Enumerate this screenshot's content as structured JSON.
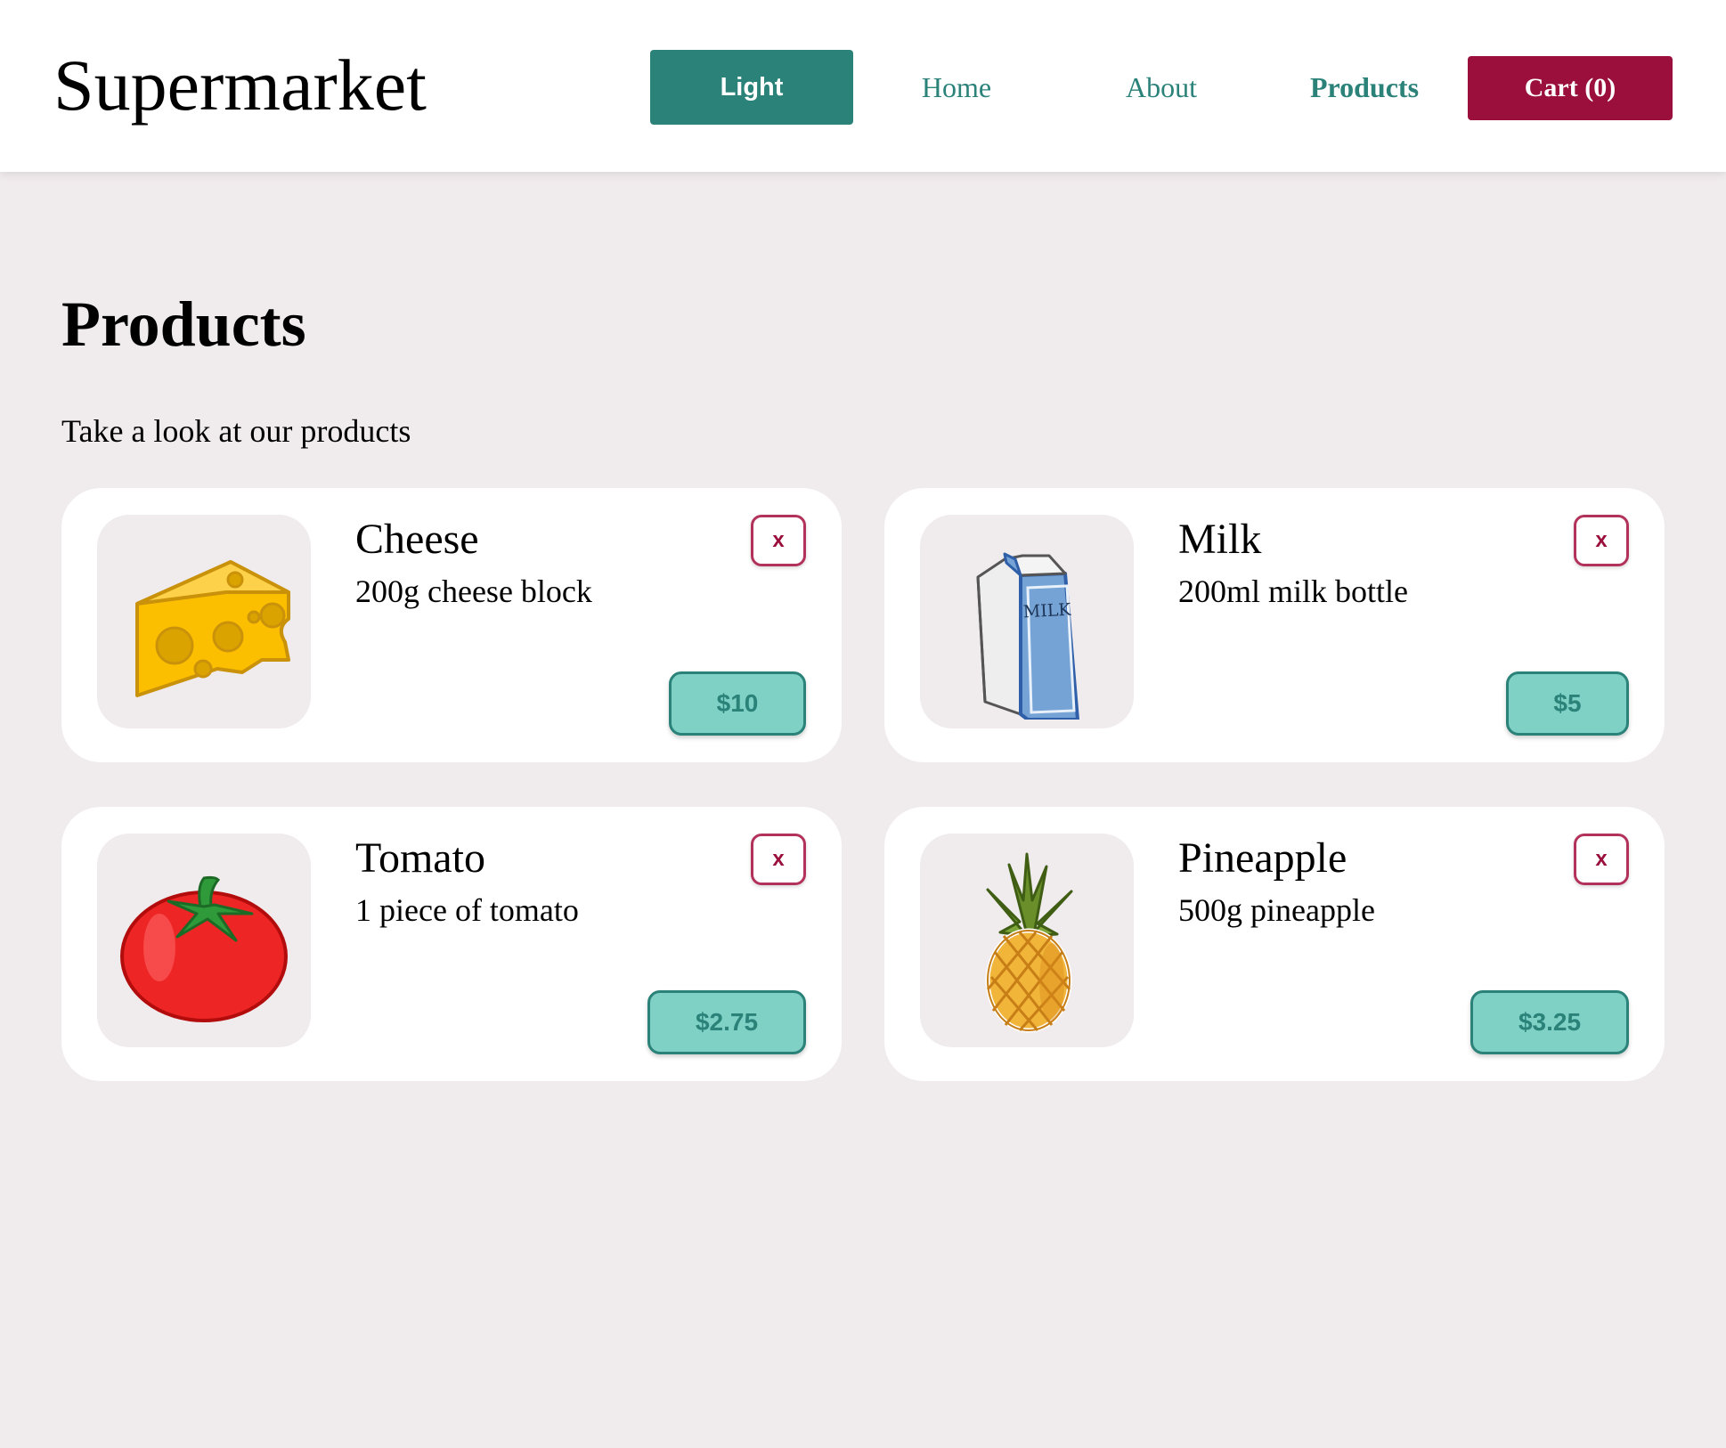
{
  "header": {
    "logo": "Supermarket",
    "theme_toggle_label": "Light",
    "nav": {
      "home": "Home",
      "about": "About",
      "products": "Products"
    },
    "cart_label": "Cart (0)"
  },
  "main": {
    "title": "Products",
    "subtitle": "Take a look at our products"
  },
  "products": [
    {
      "name": "Cheese",
      "description": "200g cheese block",
      "price": "$10",
      "remove_label": "x",
      "icon": "cheese-icon"
    },
    {
      "name": "Milk",
      "description": "200ml milk bottle",
      "price": "$5",
      "remove_label": "x",
      "icon": "milk-carton-icon",
      "icon_text": "MILK"
    },
    {
      "name": "Tomato",
      "description": "1 piece of tomato",
      "price": "$2.75",
      "remove_label": "x",
      "icon": "tomato-icon"
    },
    {
      "name": "Pineapple",
      "description": "500g pineapple",
      "price": "$3.25",
      "remove_label": "x",
      "icon": "pineapple-icon"
    }
  ],
  "colors": {
    "accent": "#2a8279",
    "cart": "#9a0f3c",
    "price_bg": "#7fd0c5",
    "remove_border": "#b3325b",
    "background": "#f0ebed"
  }
}
